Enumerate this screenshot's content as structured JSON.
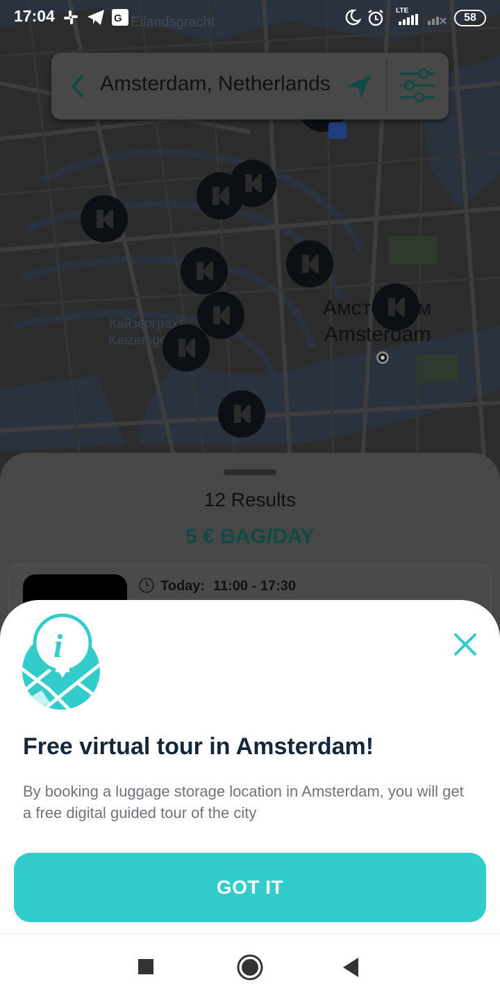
{
  "status_bar": {
    "time": "17:04",
    "battery": "58",
    "network": "LTE"
  },
  "map": {
    "city_label_ru": "Амстердам",
    "city_label_en": "Amsterdam",
    "district_ru": "Кайзерграхт",
    "district_en": "Keizersgracht",
    "street_top": "Eilandsgracht",
    "pin_icon": "bounce-logo-icon"
  },
  "search": {
    "location": "Amsterdam, Netherlands",
    "back_icon": "chevron-left-icon",
    "nav_icon": "navigation-arrow-icon",
    "filter_icon": "sliders-icon"
  },
  "sheet": {
    "results": "12 Results",
    "price": "5 € BAG/DAY",
    "card": {
      "today_label": "Today:",
      "hours": "11:00 - 17:30"
    }
  },
  "modal": {
    "title": "Free virtual tour in Amsterdam!",
    "body": "By booking a luggage storage location in Amsterdam, you will get a free digital guided tour of the city",
    "button": "GOT IT",
    "close_icon": "close-icon",
    "illustration_icon": "info-map-icon"
  },
  "colors": {
    "accent": "#33CCCC",
    "title": "#14263A",
    "body_text": "#6F747A"
  },
  "navbar": {
    "recents_icon": "square-icon",
    "home_icon": "circle-icon",
    "back_icon": "triangle-back-icon"
  }
}
